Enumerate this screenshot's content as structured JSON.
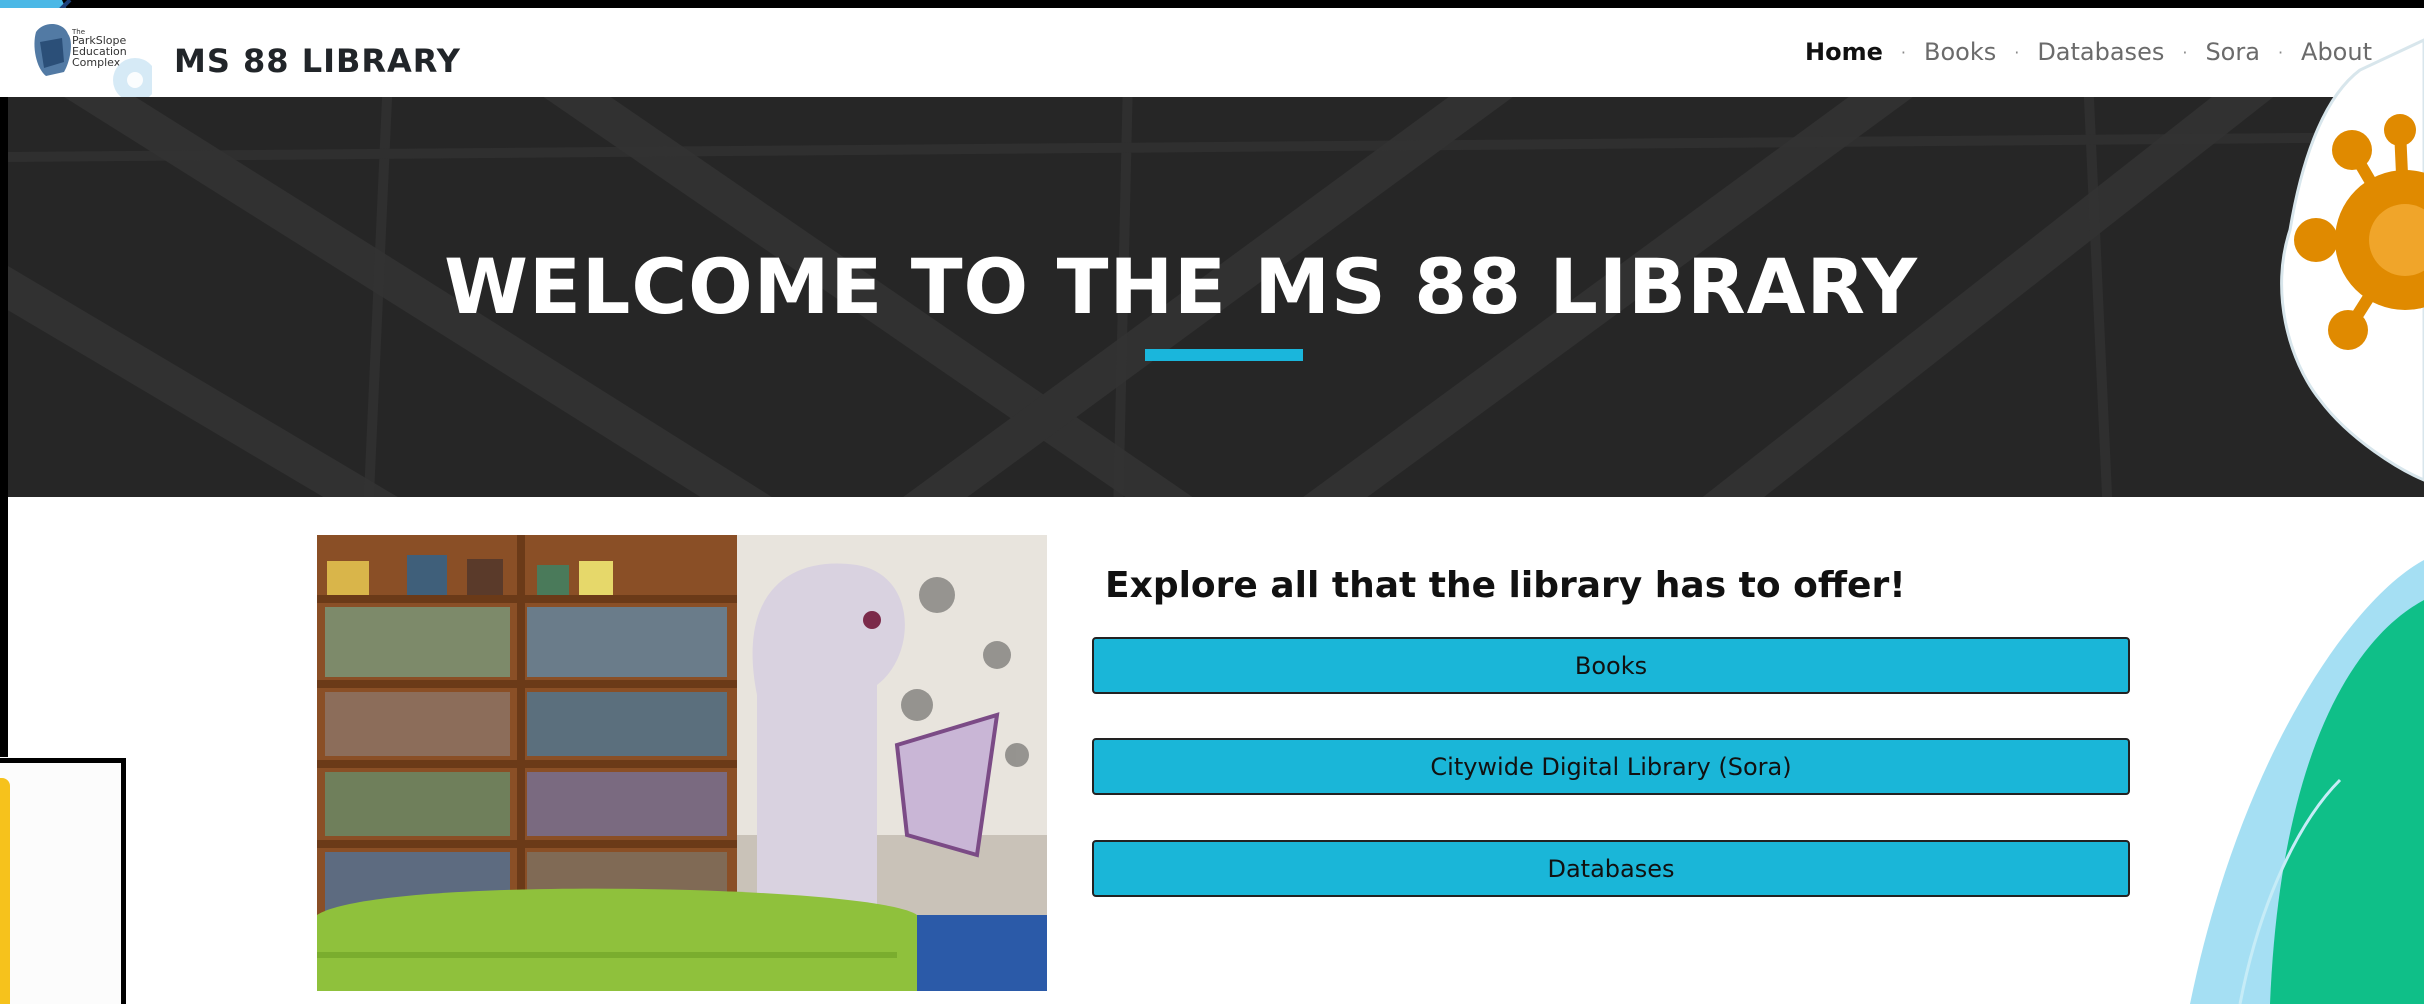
{
  "brand": {
    "logo_lines": [
      "The",
      "ParkSlope",
      "Education",
      "Complex"
    ],
    "title": "MS 88 LIBRARY"
  },
  "nav": {
    "items": [
      {
        "label": "Home",
        "active": true
      },
      {
        "label": "Books",
        "active": false
      },
      {
        "label": "Databases",
        "active": false
      },
      {
        "label": "Sora",
        "active": false
      },
      {
        "label": "About",
        "active": false
      }
    ],
    "separator": "·"
  },
  "hero": {
    "title": "WELCOME TO THE MS 88 LIBRARY"
  },
  "main": {
    "heading": "Explore all that the library has to offer!",
    "buttons": [
      {
        "label": "Books"
      },
      {
        "label": "Citywide Digital Library (Sora)"
      },
      {
        "label": "Databases"
      }
    ]
  },
  "colors": {
    "accent": "#1ab6d8",
    "hero_bg": "#232323",
    "deco_orange": "#e08a00",
    "deco_green": "#0fbf88",
    "deco_blue": "#5bc7ea"
  }
}
